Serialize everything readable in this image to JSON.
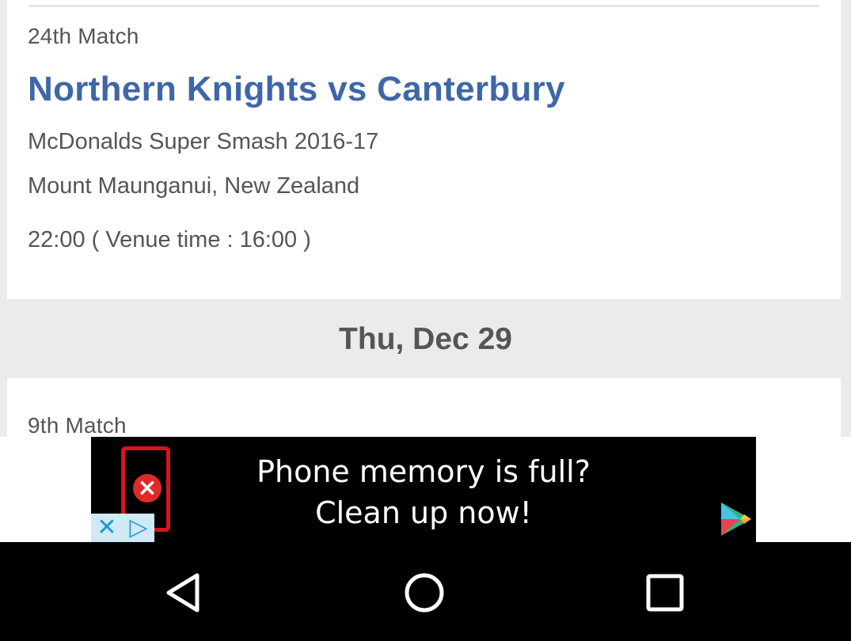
{
  "match_1": {
    "number": "24th Match",
    "title": "Northern Knights vs Canterbury",
    "series": "McDonalds Super Smash 2016-17",
    "venue": "Mount Maunganui, New Zealand",
    "time": "22:00 ( Venue time : 16:00 )"
  },
  "date_header": "Thu, Dec 29",
  "match_2": {
    "number": "9th Match"
  },
  "ad": {
    "line1": "Phone memory is full?",
    "line2": "Clean up now!",
    "choices_close_icon": "close-icon",
    "choices_info_icon": "adchoices-icon",
    "play_icon": "google-play-icon"
  },
  "navbar": {
    "back_icon": "back-icon",
    "home_icon": "home-icon",
    "recents_icon": "recents-icon"
  },
  "colors": {
    "title": "#3d67a8",
    "text": "#555555",
    "background": "#ebebeb",
    "ad_background": "#000000",
    "ad_accent": "#d7141a"
  }
}
